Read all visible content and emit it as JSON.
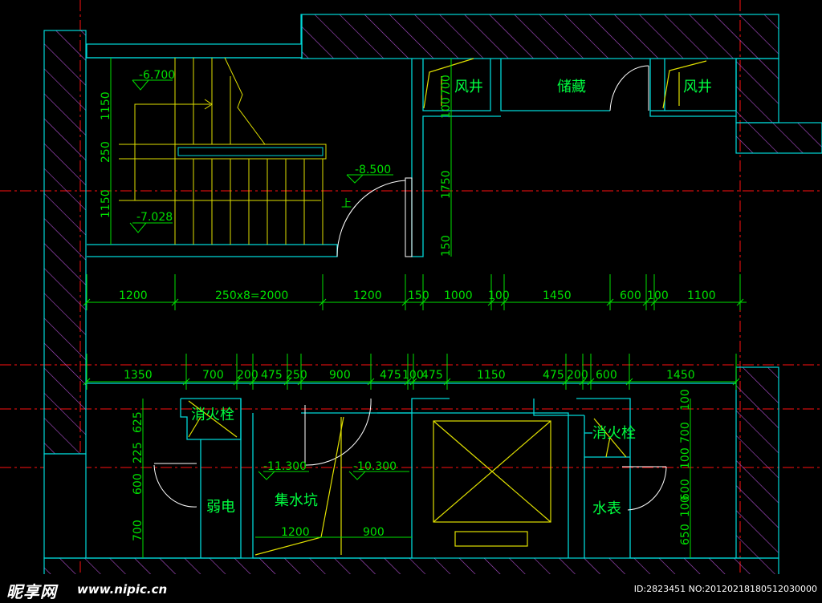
{
  "colors": {
    "background": "#000000",
    "wall_outline": "#00d8d8",
    "hatch": "#b050d0",
    "grid_axis": "#ff1010",
    "dimension": "#00e000",
    "stair_and_fixtures": "#e0e000",
    "room_label": "#00ff40",
    "door_arc": "#ffffff"
  },
  "upper_floor": {
    "stair_levels": [
      "-6.700",
      "-7.028"
    ],
    "corridor_level": "-8.500",
    "up_marker": "上",
    "rooms": [
      "风井",
      "储藏",
      "风井"
    ],
    "left_dims": [
      "1150",
      "250",
      "1150"
    ],
    "center_dims": [
      "700",
      "100",
      "1750",
      "150"
    ],
    "bottom_dims": [
      "1200",
      "250x8=2000",
      "1200",
      "150",
      "1000",
      "100",
      "1450",
      "600",
      "100",
      "1100"
    ]
  },
  "lower_floor": {
    "top_dims": [
      "1350",
      "700",
      "200",
      "475",
      "250",
      "900",
      "475",
      "100",
      "475",
      "1150",
      "475",
      "200",
      "600",
      "1450"
    ],
    "left_dims": [
      "625",
      "225",
      "600",
      "700"
    ],
    "right_dims": [
      "100",
      "700",
      "100",
      "600",
      "100",
      "650"
    ],
    "inner_dims": [
      "1200",
      "900"
    ],
    "levels": [
      "-11.300",
      "-10.300"
    ],
    "rooms": [
      "消火栓",
      "消火栓",
      "集水坑",
      "弱电",
      "水表"
    ]
  },
  "watermark": {
    "logo": "昵享网",
    "url": "www.nipic.cn",
    "id": "ID:2823451 NO:20120218180512030000"
  }
}
